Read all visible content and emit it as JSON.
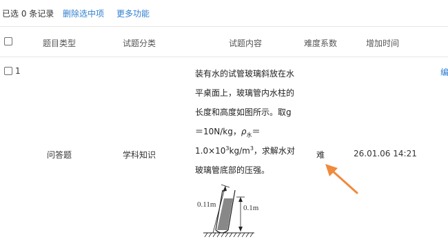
{
  "toolbar": {
    "selected_text": "已选 0 条记录",
    "delete_label": "删除选中项",
    "more_label": "更多功能"
  },
  "table": {
    "headers": [
      "题目类型",
      "试题分类",
      "试题内容",
      "难度系数",
      "增加时间"
    ],
    "row": {
      "index": "1",
      "type": "问答题",
      "category": "学科知识",
      "content_lines": [
        "装有水的试管玻璃斜放在水",
        "平桌面上，玻璃管内水柱的",
        "长度和高度如图所示。取g",
        "＝10N/kg，"
      ],
      "rho_symbol": "ρ",
      "rho_sub": "水",
      "eq_sign": "＝",
      "density_value": "1.0×10",
      "density_exp": "3",
      "density_unit": "kg/m",
      "density_unit_exp": "3",
      "density_tail": "，求解水对",
      "last_line": "玻璃管底部的压强。",
      "figure": {
        "label_length": "0.11m",
        "label_height": "0.1m"
      },
      "difficulty": "难",
      "time": "26.01.06 14:21",
      "edit_label": "编"
    }
  },
  "colors": {
    "link": "#2f7fd1",
    "arrow": "#f08a3c",
    "border": "#e6e6e6"
  }
}
